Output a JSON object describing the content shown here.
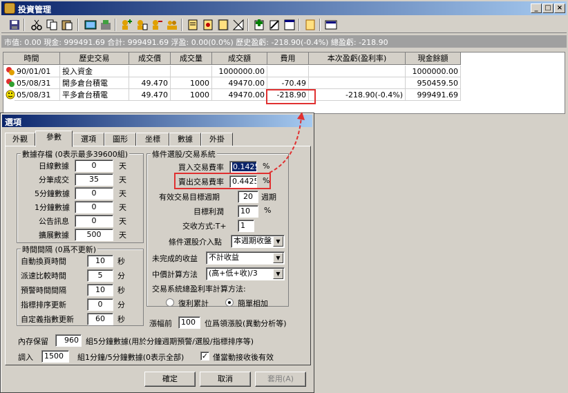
{
  "window": {
    "title": "投資管理",
    "buttons": [
      "_",
      "□",
      "×"
    ]
  },
  "toolbar": {
    "icons": [
      "save-icon",
      "cut-icon",
      "copy-icon",
      "paste-icon",
      "picture-icon",
      "tools-icon",
      "add-user-icon",
      "user-doc-icon",
      "remove-user-icon",
      "users-icon",
      "book1-icon",
      "book2-icon",
      "book3-icon",
      "config-icon",
      "add-icon",
      "edit-icon",
      "window-icon",
      "notes-icon",
      "grid-icon"
    ]
  },
  "status": {
    "text": "市值: 0.00 現金: 999491.69 合計: 999491.69 浮盈: 0.00(0.0%) 歷史盈虧: -218.90(-0.4%) 總盈虧: -218.90"
  },
  "table": {
    "headers": [
      "時間",
      "歷史交易",
      "成交價",
      "成交量",
      "成交額",
      "費用",
      "本次盈虧(盈利率)",
      "現金餘額"
    ],
    "rows": [
      {
        "icon": "money-icon",
        "time": "90/01/01",
        "type": "投入資金",
        "price": "",
        "qty": "",
        "amount": "1000000.00",
        "fee": "",
        "pnl": "",
        "cash": "1000000.00"
      },
      {
        "icon": "money-icon",
        "time": "05/08/31",
        "type": "開多倉台積電",
        "price": "49.470",
        "qty": "1000",
        "amount": "49470.00",
        "fee": "-70.49",
        "pnl": "",
        "cash": "950459.50"
      },
      {
        "icon": "smiley-icon",
        "time": "05/08/31",
        "type": "平多倉台積電",
        "price": "49.470",
        "qty": "1000",
        "amount": "49470.00",
        "fee": "-218.90",
        "pnl": "-218.90(-0.4%)",
        "cash": "999491.69"
      }
    ]
  },
  "dialog": {
    "title": "選項",
    "tabs": [
      "外觀",
      "參數",
      "選項",
      "圖形",
      "坐標",
      "數據",
      "外掛"
    ],
    "active_tab": "參數",
    "storage": {
      "title": "數據存檔 (0表示最多39600組)",
      "rows": [
        {
          "label": "日線數據",
          "value": "0",
          "unit": "天"
        },
        {
          "label": "分筆成交",
          "value": "35",
          "unit": "天"
        },
        {
          "label": "5分鐘數據",
          "value": "0",
          "unit": "天"
        },
        {
          "label": "1分鐘數據",
          "value": "0",
          "unit": "天"
        },
        {
          "label": "公告訊息",
          "value": "0",
          "unit": "天"
        },
        {
          "label": "擴展數據",
          "value": "500",
          "unit": "天"
        }
      ]
    },
    "interval": {
      "title": "時間間隔 (0爲不更新)",
      "rows": [
        {
          "label": "自動換頁時間",
          "value": "10",
          "unit": "秒"
        },
        {
          "label": "派速比較時間",
          "value": "5",
          "unit": "分"
        },
        {
          "label": "預警時間間隔",
          "value": "10",
          "unit": "秒"
        },
        {
          "label": "指標排序更新",
          "value": "0",
          "unit": "分"
        },
        {
          "label": "自定義指數更新",
          "value": "60",
          "unit": "秒"
        }
      ]
    },
    "system": {
      "title": "條件選股/交易系統",
      "buy_fee_label": "買入交易費率",
      "buy_fee_value": "0.1425",
      "sell_fee_label": "賣出交易費率",
      "sell_fee_value": "0.4425",
      "pct": "%",
      "period_label": "有效交易目標週期",
      "period_value": "20",
      "period_unit": "週期",
      "profit_label": "目標利潤",
      "profit_value": "10",
      "settle_label": "交收方式:T+",
      "settle_value": "1",
      "entry_label": "條件選股介入點",
      "entry_value": "本週期收盤",
      "unfinished_label": "未完成的收益",
      "unfinished_value": "不計收益",
      "median_label": "中價計算方法",
      "median_value": "(高+低+收)/3",
      "total_method_label": "交易系統總盈利率計算方法:",
      "opt_compound": "復利累計",
      "opt_simple": "簡單相加",
      "selected_option": "簡單相加"
    },
    "leading": {
      "label_before": "漲幅前",
      "value": "100",
      "label_after": "位爲領漲股(異動分析等)"
    },
    "memory": {
      "label": "內存保留",
      "value": "960",
      "text": "組5分鐘數據(用於分鐘週期預警/選股/指標排序等)"
    },
    "load": {
      "label": "調入",
      "value": "1500",
      "text": "組1分鐘/5分鐘數據(0表示全部)"
    },
    "active_only": {
      "label": "僅當動接收後有效",
      "checked": true
    },
    "buttons": {
      "ok": "確定",
      "cancel": "取消",
      "apply": "套用(A)"
    }
  }
}
